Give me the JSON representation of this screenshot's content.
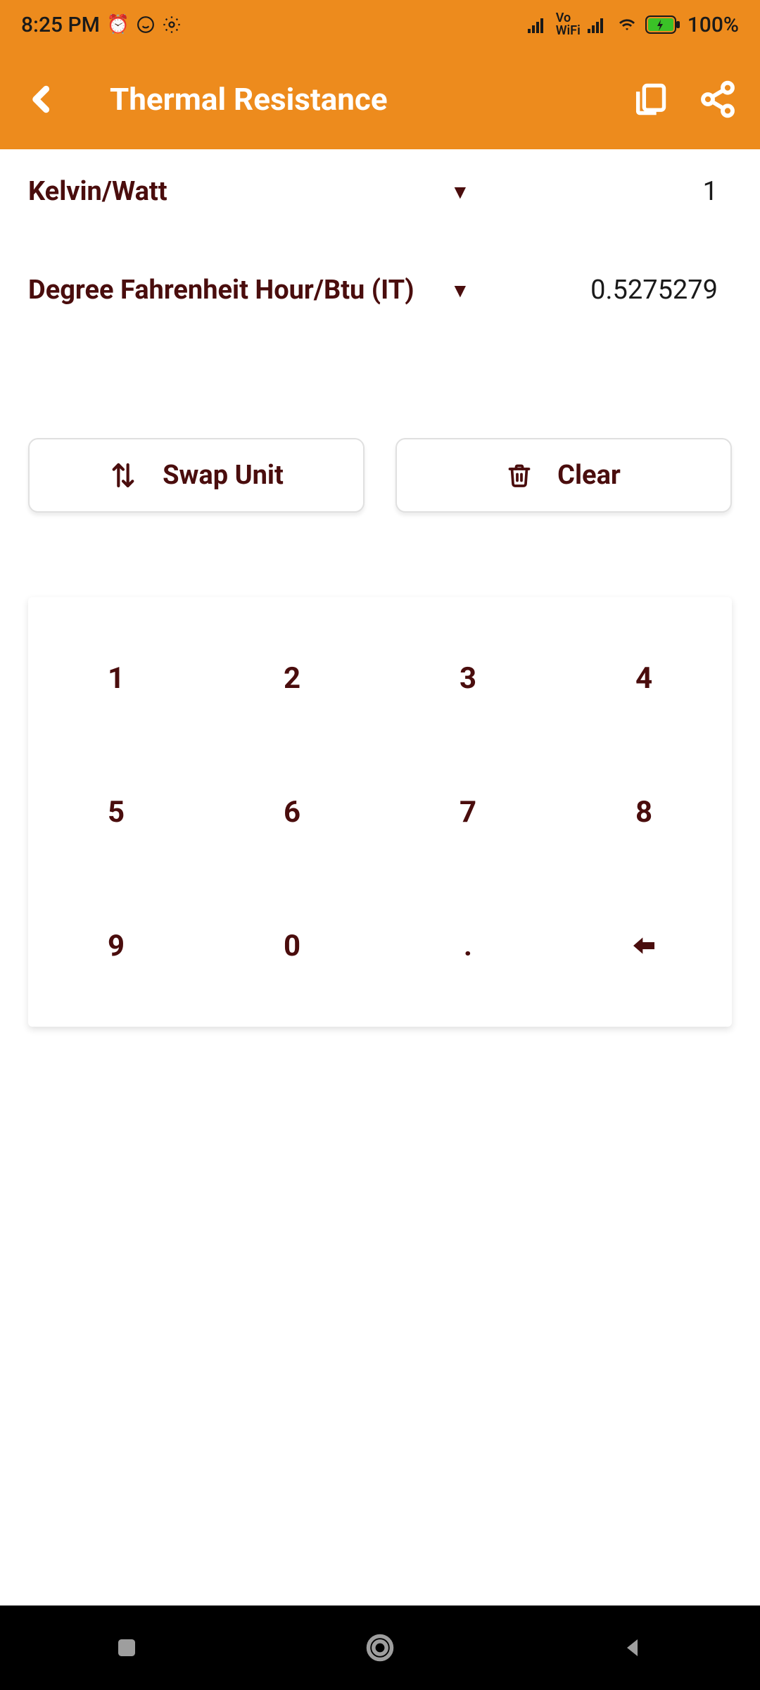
{
  "status": {
    "time": "8:25 PM",
    "battery": "100%"
  },
  "header": {
    "title": "Thermal Resistance"
  },
  "converter": {
    "from_unit": "Kelvin/Watt",
    "from_value": "1",
    "to_unit": "Degree Fahrenheit Hour/Btu (IT)",
    "to_value": "0.5275279"
  },
  "actions": {
    "swap_label": "Swap Unit",
    "clear_label": "Clear"
  },
  "keypad": {
    "keys": [
      [
        "1",
        "2",
        "3",
        "4"
      ],
      [
        "5",
        "6",
        "7",
        "8"
      ],
      [
        "9",
        "0",
        ".",
        "⬅"
      ]
    ]
  },
  "colors": {
    "accent": "#ed8b1d",
    "textDark": "#4a0d0d"
  }
}
